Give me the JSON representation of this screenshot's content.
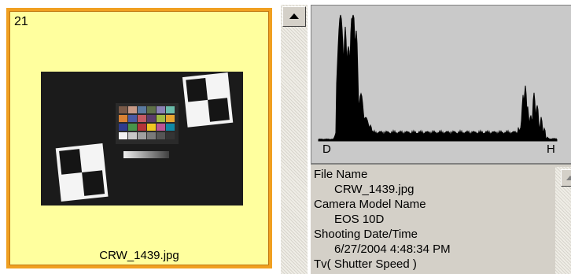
{
  "thumbnail": {
    "number": "21",
    "filename": "CRW_1439.jpg"
  },
  "histogram": {
    "left_label": "D",
    "right_label": "H"
  },
  "info": {
    "items": [
      {
        "label": "File Name",
        "value": "CRW_1439.jpg"
      },
      {
        "label": "Camera Model Name",
        "value": "EOS 10D"
      },
      {
        "label": "Shooting Date/Time",
        "value": "6/27/2004 4:48:34 PM"
      },
      {
        "label": "Tv( Shutter Speed )",
        "value": ""
      }
    ]
  },
  "colors": {
    "selection_fill": "#ffff9e",
    "selection_border": "#f0a021",
    "panel_gray": "#d4d0c8",
    "histogram_bg": "#c9c9c9"
  },
  "icons": {
    "scroll_up": "up-arrow-icon"
  }
}
